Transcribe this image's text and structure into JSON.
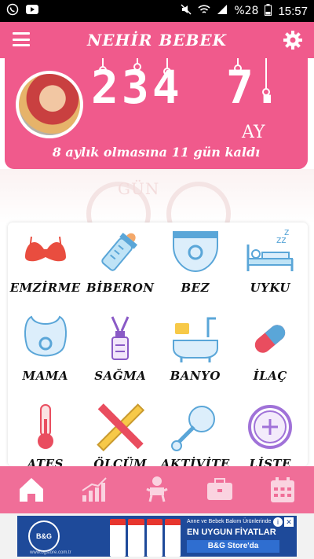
{
  "status_bar": {
    "battery": "%28",
    "time": "15:57"
  },
  "app_bar": {
    "title": "NEHİR BEBEK"
  },
  "header": {
    "days": "234",
    "months": "7.",
    "months_unit": "AY",
    "countdown": "8 aylık olmasına 11 gün kaldı",
    "days_unit": "GÜN"
  },
  "grid": {
    "items": [
      {
        "label": "EMZİRME",
        "icon": "bra-icon"
      },
      {
        "label": "BİBERON",
        "icon": "baby-bottle-icon"
      },
      {
        "label": "BEZ",
        "icon": "diaper-icon"
      },
      {
        "label": "UYKU",
        "icon": "sleep-bed-icon"
      },
      {
        "label": "MAMA",
        "icon": "bib-icon"
      },
      {
        "label": "SAĞMA",
        "icon": "breast-pump-icon"
      },
      {
        "label": "BANYO",
        "icon": "bathtub-icon"
      },
      {
        "label": "İLAÇ",
        "icon": "pill-icon"
      },
      {
        "label": "ATEŞ",
        "icon": "thermometer-icon"
      },
      {
        "label": "ÖLÇÜM",
        "icon": "ruler-pencil-icon"
      },
      {
        "label": "AKTİVİTE",
        "icon": "rattle-icon"
      },
      {
        "label": "LİSTE",
        "icon": "add-circle-icon"
      }
    ]
  },
  "bottom_nav": {
    "items": [
      "home-icon",
      "chart-icon",
      "baby-icon",
      "briefcase-icon",
      "calendar-icon"
    ],
    "active": 0
  },
  "ad": {
    "brand": "B&G",
    "brand_sub": "www.bgstore.com.tr",
    "line1": "Anne ve Bebek Bakım Ürünlerinde",
    "line2": "EN UYGUN FİYATLAR",
    "line3": "B&G Store'da"
  },
  "colors": {
    "primary": "#f05a8c",
    "nav": "#f06e98",
    "ad": "#1e4a9a"
  }
}
